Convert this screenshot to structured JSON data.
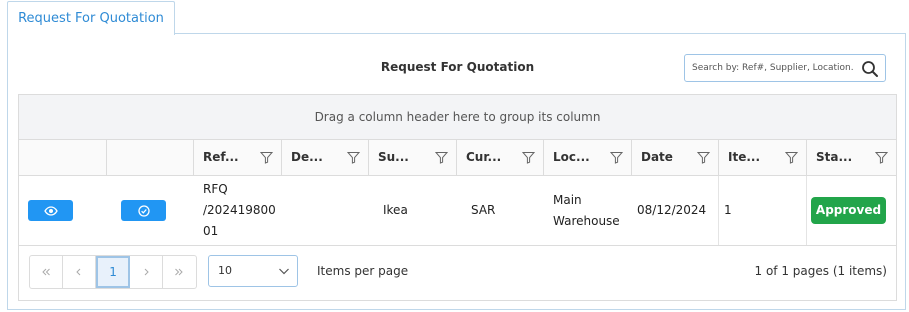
{
  "tab": {
    "label": "Request For Quotation"
  },
  "panel": {
    "title": "Request For Quotation"
  },
  "search": {
    "placeholder": "Search by: Ref#, Supplier, Location."
  },
  "grid": {
    "group_hint": "Drag a column header here to group its column",
    "columns": [
      "Ref...",
      "De...",
      "Su...",
      "Cur...",
      "Loc...",
      "Date",
      "Ite...",
      "Sta..."
    ],
    "rows": [
      {
        "ref_line1": "RFQ",
        "ref_line2": "/202419800",
        "ref_line3": "01",
        "description": "",
        "supplier": "Ikea",
        "currency": "SAR",
        "location_line1": "Main",
        "location_line2": "Warehouse",
        "date": "08/12/2024",
        "items": "1",
        "status": "Approved"
      }
    ]
  },
  "pager": {
    "current_page": "1",
    "page_size": "10",
    "items_per_page_label": "Items per page",
    "info": "1 of 1 pages (1 items)"
  },
  "colors": {
    "accent": "#2196f3",
    "approved": "#22a54a",
    "tab_text": "#2f8bd5"
  },
  "icons": [
    "eye-icon",
    "check-circle-icon",
    "filter-icon",
    "search-icon",
    "chevron-down-icon"
  ]
}
